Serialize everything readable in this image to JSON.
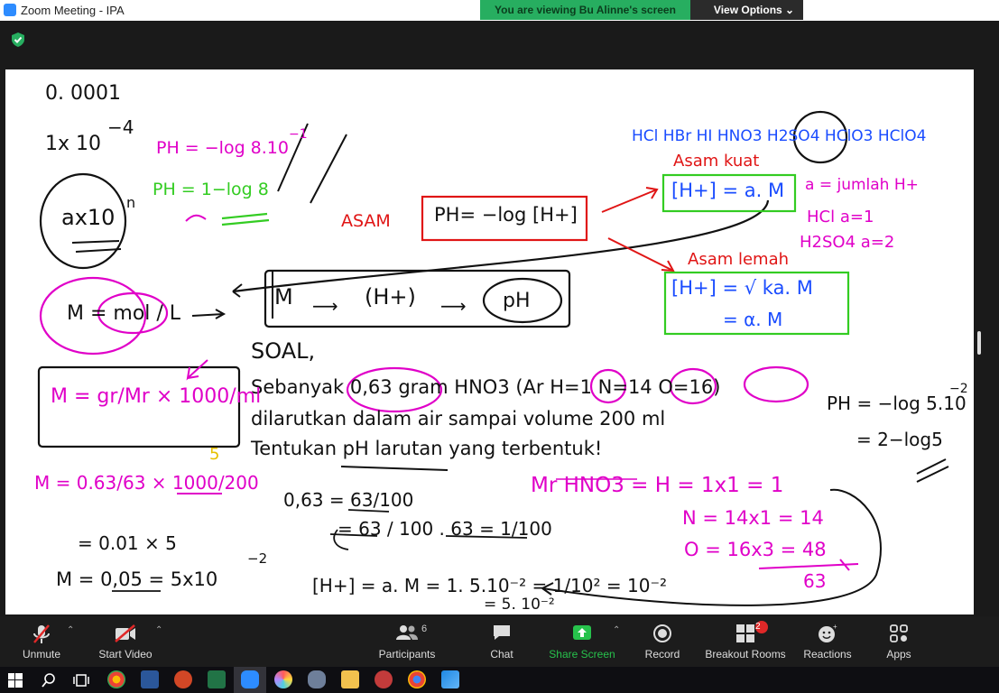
{
  "window": {
    "title": "Zoom Meeting - IPA"
  },
  "banner": {
    "viewing_text": "You are viewing Bu Alinne's screen",
    "view_options_label": "View Options ⌄"
  },
  "whiteboard": {
    "left_notes": [
      "0. 0001",
      "1x 10",
      "−4",
      "ax10",
      "n"
    ],
    "green_notes": [
      "PH = −log 8.10",
      "−1",
      "PH = 1−log 8"
    ],
    "asam_label": "ASAM",
    "ph_formula": "PH= −log [H+]",
    "acids_row": "HCl  HBr  HI  HNO3  H2SO4  HClO3  HClO4",
    "asam_kuat": "Asam kuat",
    "strong_formula": "[H+] = a. M",
    "a_definition": "a = jumlah H+",
    "hcl_example": "HCl   a=1",
    "h2so4_example": "H2SO4  a=2",
    "asam_lemah": "Asam lemah",
    "weak_formula_1": "[H+] = √ ka. M",
    "weak_formula_2": "= α. M",
    "flow_m": "M",
    "flow_h": "(H+)",
    "flow_ph": "pH",
    "molarity_def": "M = mol / L",
    "molarity_formula": "M = gr/Mr × 1000/ml",
    "soal_label": "SOAL,",
    "question_line_1": "Sebanyak 0,63 gram HNO3 (Ar H=1  N=14  O=16)",
    "question_line_2": "dilarutkan dalam air sampai volume 200 ml",
    "question_line_3": "Tentukan pH larutan yang terbentuk!",
    "calc_m": "M = 0.63/63 × 1000/200",
    "calc_five": "5",
    "calc_2": "= 0.01 × 5",
    "calc_3": "M = 0,05 = 5x10",
    "calc_exp": "−2",
    "fraction_1": "0,63 = 63/100",
    "fraction_2": "= 63 / 100 . 63 = 1/100",
    "h_conc": "[H+] = a. M = 1. 5.10⁻² = 1/10² = 10⁻²",
    "h_conc_2": "= 5. 10⁻²",
    "mr_title": "Mr HNO3 = H = 1x1 = 1",
    "mr_n": "N = 14x1 = 14",
    "mr_o": "O = 16x3 = 48",
    "mr_total": "63",
    "ph_answer_1": "PH = −log 5.10",
    "ph_answer_exp": "−2",
    "ph_answer_2": "= 2−log5"
  },
  "toolbar": {
    "unmute": "Unmute",
    "start_video": "Start Video",
    "participants": "Participants",
    "participants_count": "6",
    "chat": "Chat",
    "share_screen": "Share Screen",
    "record": "Record",
    "breakout_rooms": "Breakout Rooms",
    "breakout_badge": "2",
    "reactions": "Reactions",
    "apps": "Apps"
  },
  "colors": {
    "ink_black": "#111111",
    "ink_pink": "#e000c8",
    "ink_red": "#e01515",
    "ink_green": "#33cc22",
    "ink_blue": "#1a4cff",
    "share_green": "#27c24c"
  }
}
